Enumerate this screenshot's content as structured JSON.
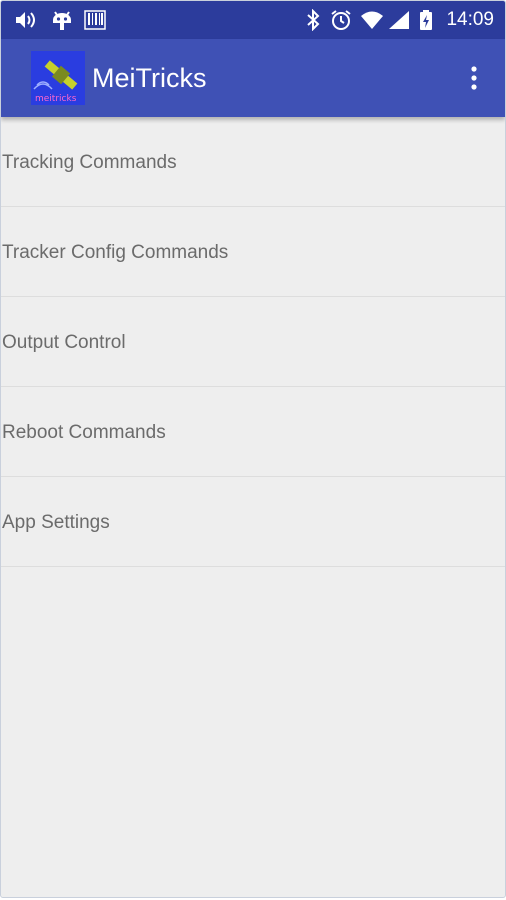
{
  "status_bar": {
    "time": "14:09",
    "left_icons": [
      "volume-icon",
      "android-debug-icon",
      "barcode-icon"
    ],
    "right_icons": [
      "bluetooth-icon",
      "alarm-icon",
      "wifi-icon",
      "signal-icon",
      "battery-charging-icon"
    ],
    "background_color": "#2c3c9c"
  },
  "app_bar": {
    "title": "MeiTricks",
    "logo_text": "meitricks",
    "background_color": "#3f51b5",
    "overflow_icon": "more-vert-icon"
  },
  "menu": {
    "items": [
      {
        "label": "Tracking Commands"
      },
      {
        "label": "Tracker Config Commands"
      },
      {
        "label": "Output Control"
      },
      {
        "label": "Reboot Commands"
      },
      {
        "label": "App Settings"
      }
    ]
  },
  "colors": {
    "page_background": "#eeeeee",
    "item_text": "#6b6b6b",
    "divider": "#dddddd"
  }
}
